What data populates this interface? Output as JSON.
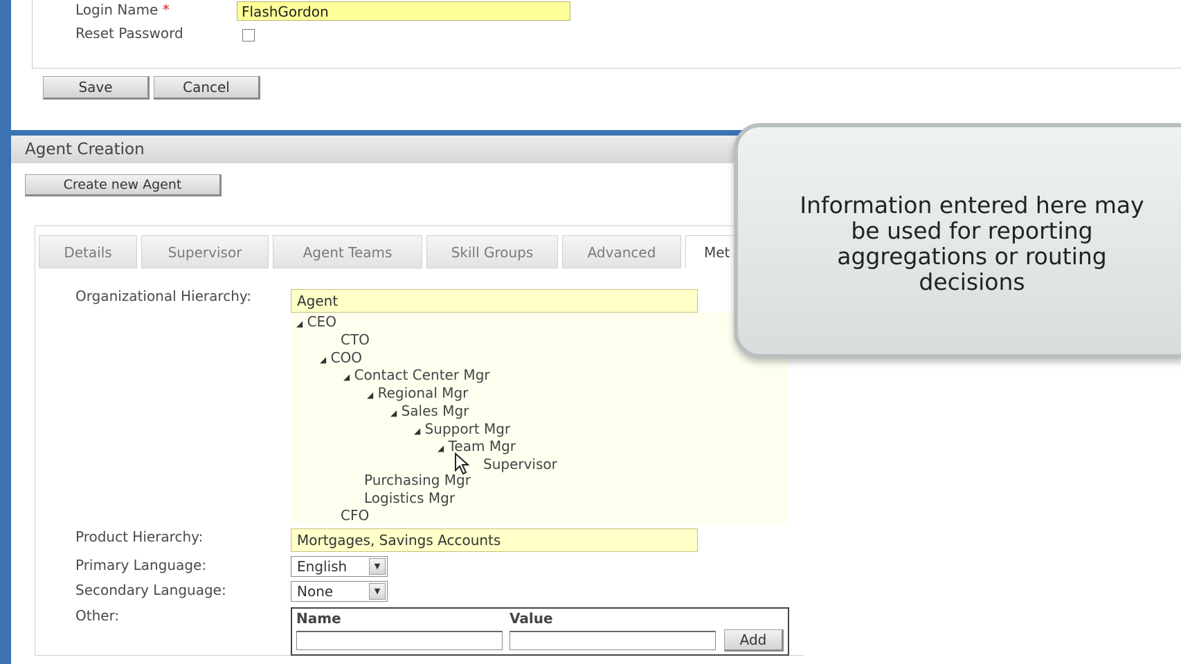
{
  "user_form": {
    "login_name_label": "Login Name",
    "required_marker": "*",
    "login_name_value": "FlashGordon",
    "reset_password_label": "Reset Password",
    "save_label": "Save",
    "cancel_label": "Cancel"
  },
  "agent_creation": {
    "title": "Agent Creation",
    "create_button_label": "Create new Agent",
    "tabs": [
      {
        "label": "Details"
      },
      {
        "label": "Supervisor"
      },
      {
        "label": "Agent Teams"
      },
      {
        "label": "Skill Groups"
      },
      {
        "label": "Advanced"
      },
      {
        "label": "Met"
      }
    ],
    "org_hierarchy_label": "Organizational Hierarchy:",
    "org_hierarchy_value": "Agent",
    "tree": [
      {
        "label": "CEO",
        "expanded": true
      },
      {
        "label": "CTO",
        "expanded": false
      },
      {
        "label": "COO",
        "expanded": true
      },
      {
        "label": "Contact Center Mgr",
        "expanded": true
      },
      {
        "label": "Regional Mgr",
        "expanded": true
      },
      {
        "label": "Sales Mgr",
        "expanded": true
      },
      {
        "label": "Support Mgr",
        "expanded": true
      },
      {
        "label": "Team Mgr",
        "expanded": true
      },
      {
        "label": "Supervisor",
        "expanded": false
      },
      {
        "label": "Purchasing Mgr",
        "expanded": false
      },
      {
        "label": "Logistics Mgr",
        "expanded": false
      },
      {
        "label": "CFO",
        "expanded": false
      }
    ],
    "product_hierarchy_label": "Product Hierarchy:",
    "product_hierarchy_value": "Mortgages, Savings Accounts",
    "primary_language_label": "Primary Language:",
    "primary_language_value": "English",
    "secondary_language_label": "Secondary Language:",
    "secondary_language_value": "None",
    "other_label": "Other:",
    "other_name_header": "Name",
    "other_value_header": "Value",
    "add_label": "Add"
  },
  "tooltip": {
    "lines": [
      "Information entered here may",
      "be used for reporting",
      "aggregations or routing",
      "decisions"
    ]
  },
  "colors": {
    "accent_blue": "#3a72b4",
    "input_yellow": "#ffff99",
    "field_yellow": "#ffffc8"
  },
  "icons": {
    "expand": "triangle-expanded-icon",
    "dropdown": "chevron-down-icon",
    "pointer": "mouse-pointer-icon"
  }
}
